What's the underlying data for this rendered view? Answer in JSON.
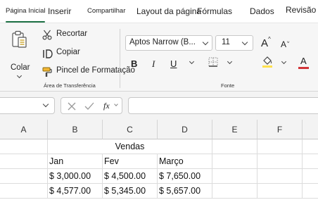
{
  "tabs": [
    {
      "label": "Página Inicial",
      "active": true
    },
    {
      "label": "Inserir"
    },
    {
      "label": "Compartilhar"
    },
    {
      "label": "Layout da página"
    },
    {
      "label": "Fórmulas"
    },
    {
      "label": "Dados"
    },
    {
      "label": "Revisão"
    }
  ],
  "clipboard": {
    "paste_label": "Colar",
    "cut_label": "Recortar",
    "copy_label": "Copiar",
    "format_painter_label": "Pincel de Formatação",
    "group_label": "Área de Transferência"
  },
  "font": {
    "name": "Aptos Narrow (B...",
    "size": "11",
    "grow_label": "A",
    "shrink_label": "A",
    "bold_label": "B",
    "italic_label": "I",
    "underline_label": "U",
    "font_color_label": "A",
    "group_label": "Fonte",
    "underline_bar_color": "#d13438",
    "fill_bar_color": "#ffe14d"
  },
  "formula_bar": {
    "name_box_value": "",
    "fx_label": "fx",
    "formula_value": ""
  },
  "columns": [
    "A",
    "B",
    "C",
    "D",
    "E",
    "F"
  ],
  "sheet": {
    "title": "Vendas",
    "months": [
      "Jan",
      "Fev",
      "Março"
    ],
    "rows": [
      [
        "$  3,000.00",
        "$  4,500.00",
        "$  7,650.00"
      ],
      [
        "$  4,577.00",
        "$  5,345.00",
        "$  5,657.00"
      ]
    ]
  },
  "colors": {
    "accent": "#1e7145"
  }
}
